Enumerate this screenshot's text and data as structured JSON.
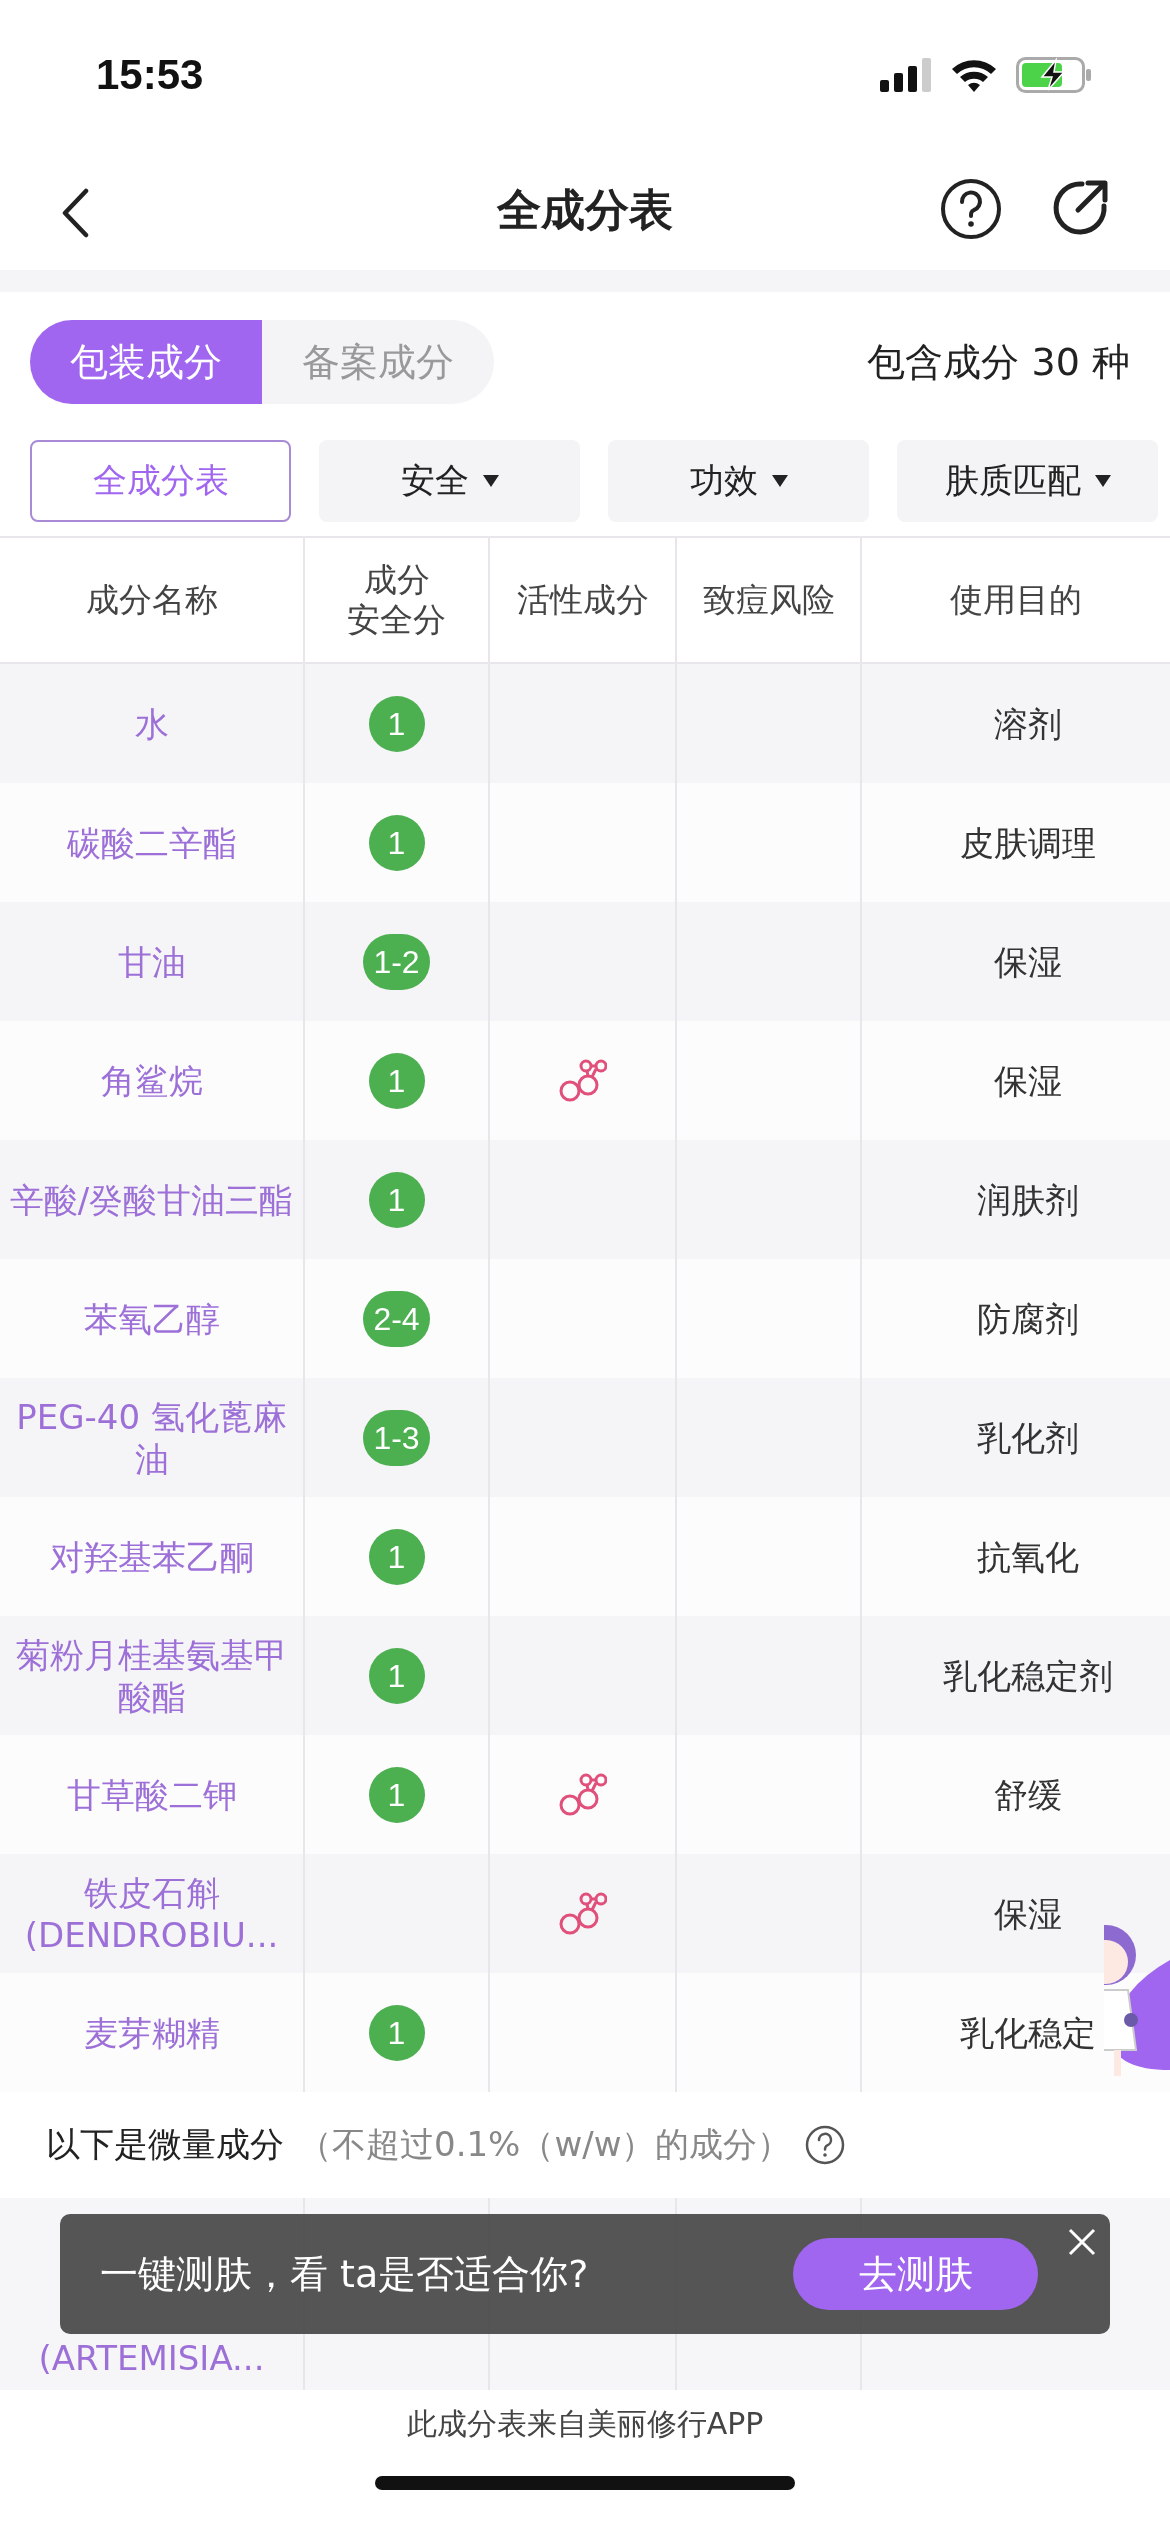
{
  "status_bar": {
    "time": "15:53"
  },
  "nav": {
    "title": "全成分表"
  },
  "tabs": [
    {
      "label": "包装成分",
      "selected": true
    },
    {
      "label": "备案成分",
      "selected": false
    }
  ],
  "ingredient_count": "包含成分 30 种",
  "filters": [
    {
      "label": "全成分表",
      "kind": "plain",
      "selected": true
    },
    {
      "label": "安全",
      "kind": "dropdown",
      "selected": false
    },
    {
      "label": "功效",
      "kind": "dropdown",
      "selected": false
    },
    {
      "label": "肤质匹配",
      "kind": "dropdown",
      "selected": false
    }
  ],
  "table": {
    "columns": [
      "成分名称",
      "成分安全分",
      "活性成分",
      "致痘风险",
      "使用目的"
    ],
    "rows": [
      {
        "name": "水",
        "score": "1",
        "active": false,
        "purpose": "溶剂"
      },
      {
        "name": "碳酸二辛酯",
        "score": "1",
        "active": false,
        "purpose": "皮肤调理"
      },
      {
        "name": "甘油",
        "score": "1-2",
        "active": false,
        "purpose": "保湿"
      },
      {
        "name": "角鲨烷",
        "score": "1",
        "active": true,
        "purpose": "保湿"
      },
      {
        "name": "辛酸/癸酸甘油三酯",
        "score": "1",
        "active": false,
        "purpose": "润肤剂"
      },
      {
        "name": "苯氧乙醇",
        "score": "2-4",
        "active": false,
        "purpose": "防腐剂"
      },
      {
        "name": "PEG-40 氢化蓖麻油",
        "score": "1-3",
        "active": false,
        "purpose": "乳化剂"
      },
      {
        "name": "对羟基苯乙酮",
        "score": "1",
        "active": false,
        "purpose": "抗氧化"
      },
      {
        "name": "菊粉月桂基氨基甲酸酯",
        "score": "1",
        "active": false,
        "purpose": "乳化稳定剂"
      },
      {
        "name": "甘草酸二钾",
        "score": "1",
        "active": true,
        "purpose": "舒缓"
      },
      {
        "name": "铁皮石斛\n(DENDROBIU...",
        "active": true,
        "purpose": "保湿"
      },
      {
        "name": "麦芽糊精",
        "score": "1",
        "active": false,
        "purpose": "乳化稳定"
      }
    ]
  },
  "trace": {
    "label": "以下是微量成分",
    "note": "（不超过0.1%（w/w）的成分）",
    "rows": [
      {
        "name": "(ARTEMISIA..."
      }
    ]
  },
  "toast": {
    "message": "一键测肤，看 ta是否适合你?",
    "button": "去测肤"
  },
  "footer": "此成分表来自美丽修行APP"
}
